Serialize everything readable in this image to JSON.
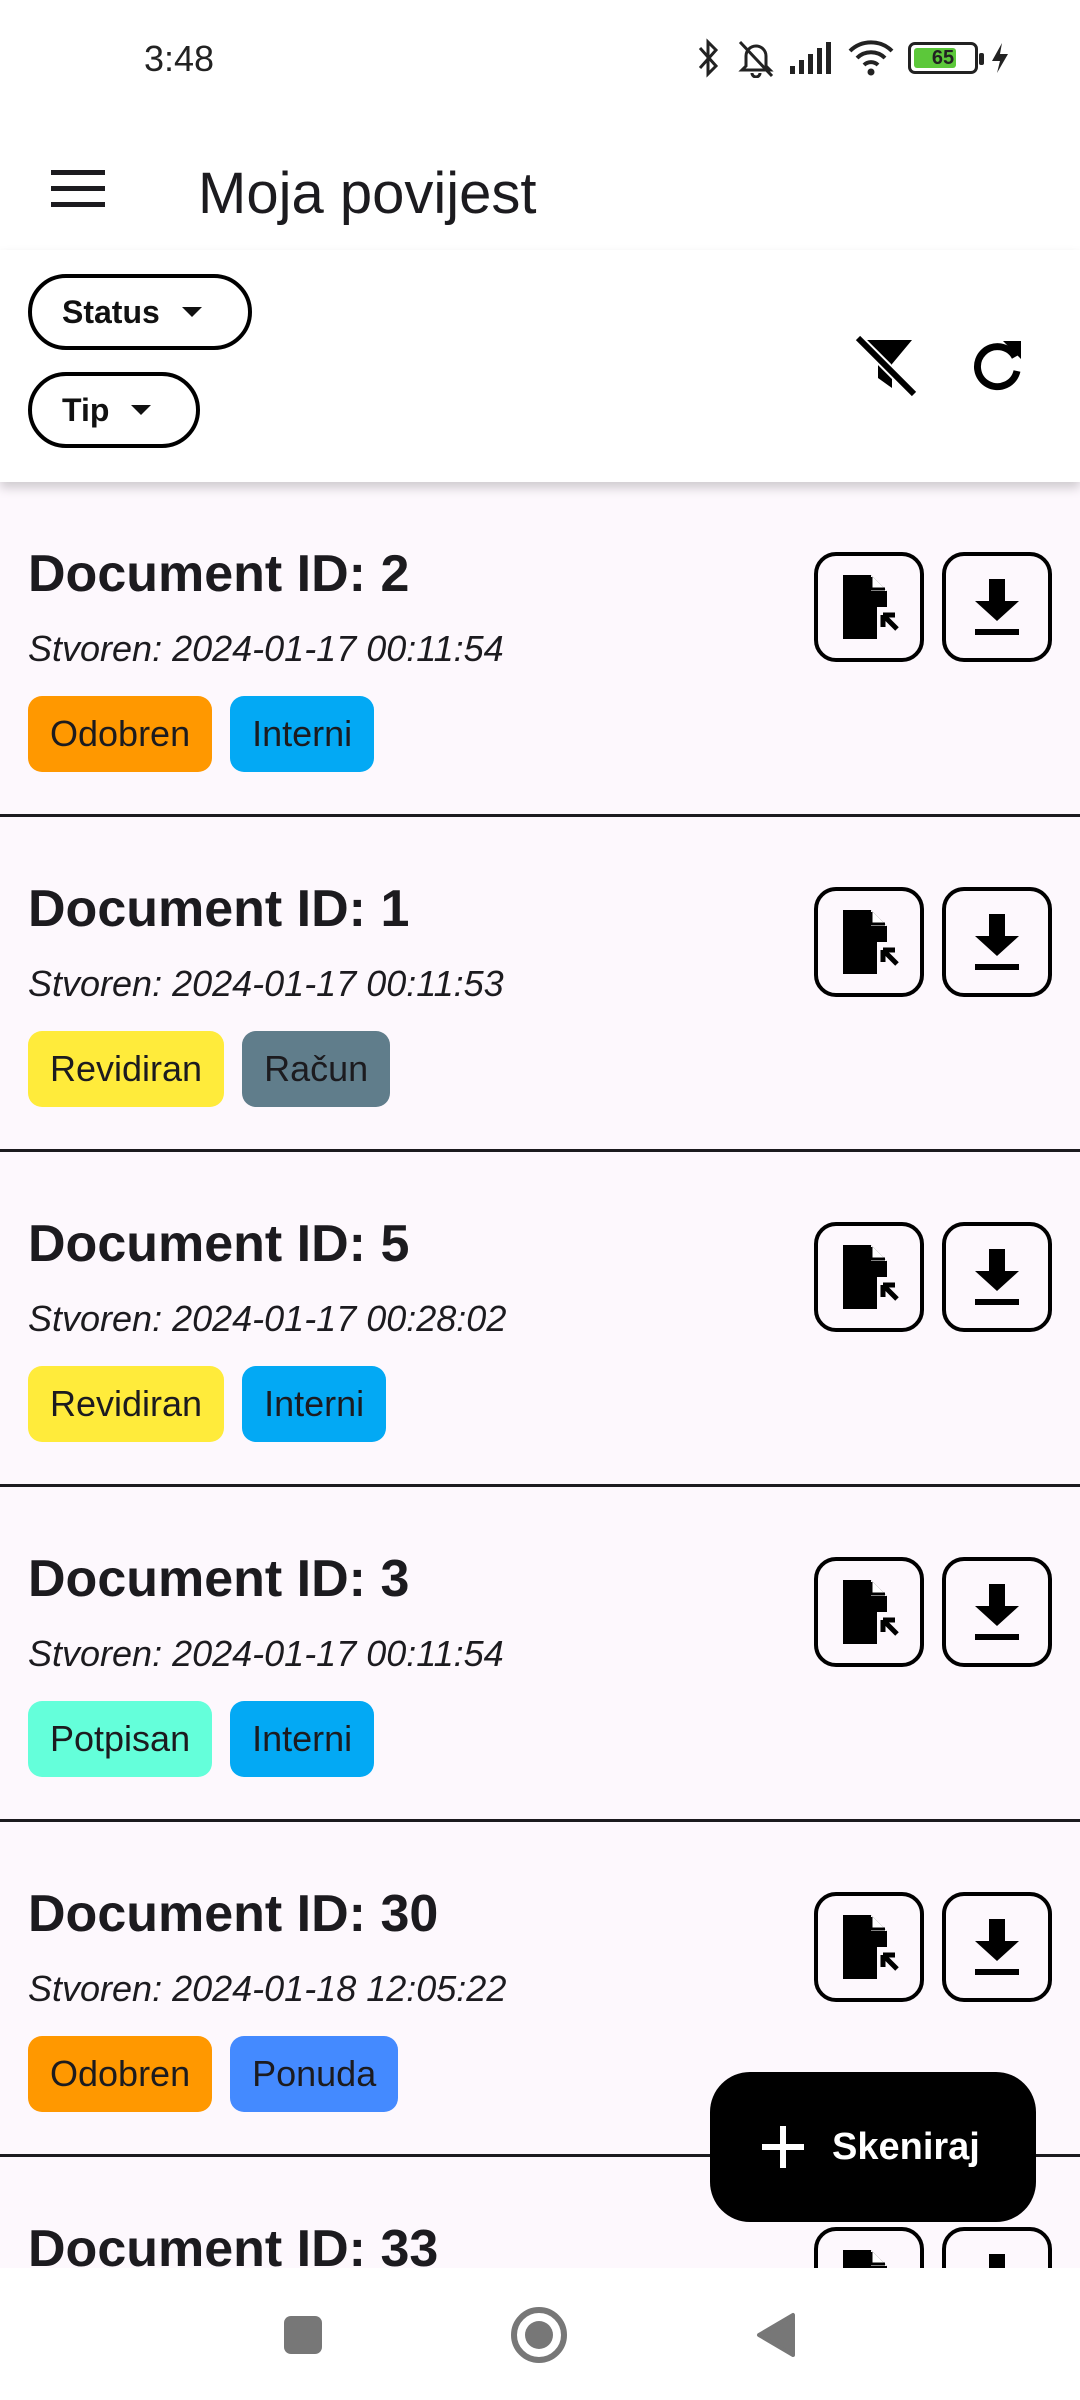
{
  "status_bar": {
    "time": "3:48",
    "battery_level": "65",
    "icons": [
      "bluetooth-icon",
      "bell-off-icon",
      "signal-icon",
      "wifi-icon",
      "battery-icon",
      "charging-icon"
    ]
  },
  "app_bar": {
    "title": "Moja povijest",
    "menu_icon": "menu-icon"
  },
  "filters": {
    "status_label": "Status",
    "type_label": "Tip",
    "clear_filter_icon": "filter-off-icon",
    "refresh_icon": "refresh-icon"
  },
  "documents": [
    {
      "title": "Document ID: 2",
      "created": "Stvoren: 2024-01-17 00:11:54",
      "status": "Odobren",
      "status_color": "#ff9800",
      "type": "Interni",
      "type_color": "#03a9f4"
    },
    {
      "title": "Document ID: 1",
      "created": "Stvoren: 2024-01-17 00:11:53",
      "status": "Revidiran",
      "status_color": "#ffeb3b",
      "type": "Račun",
      "type_color": "#607d8b"
    },
    {
      "title": "Document ID: 5",
      "created": "Stvoren: 2024-01-17 00:28:02",
      "status": "Revidiran",
      "status_color": "#ffeb3b",
      "type": "Interni",
      "type_color": "#03a9f4"
    },
    {
      "title": "Document ID: 3",
      "created": "Stvoren: 2024-01-17 00:11:54",
      "status": "Potpisan",
      "status_color": "#64ffda",
      "type": "Interni",
      "type_color": "#03a9f4"
    },
    {
      "title": "Document ID: 30",
      "created": "Stvoren: 2024-01-18 12:05:22",
      "status": "Odobren",
      "status_color": "#ff9800",
      "type": "Ponuda",
      "type_color": "#448aff"
    },
    {
      "title": "Document ID: 33",
      "created": "",
      "status": "",
      "status_color": "#ff9800",
      "type": "",
      "type_color": "#03a9f4"
    }
  ],
  "card_actions": {
    "open_icon": "file-open-icon",
    "download_icon": "download-icon"
  },
  "fab": {
    "label": "Skeniraj",
    "icon": "plus-icon"
  },
  "nav": {
    "icons": [
      "recents-square-icon",
      "home-circle-icon",
      "back-triangle-icon"
    ]
  }
}
